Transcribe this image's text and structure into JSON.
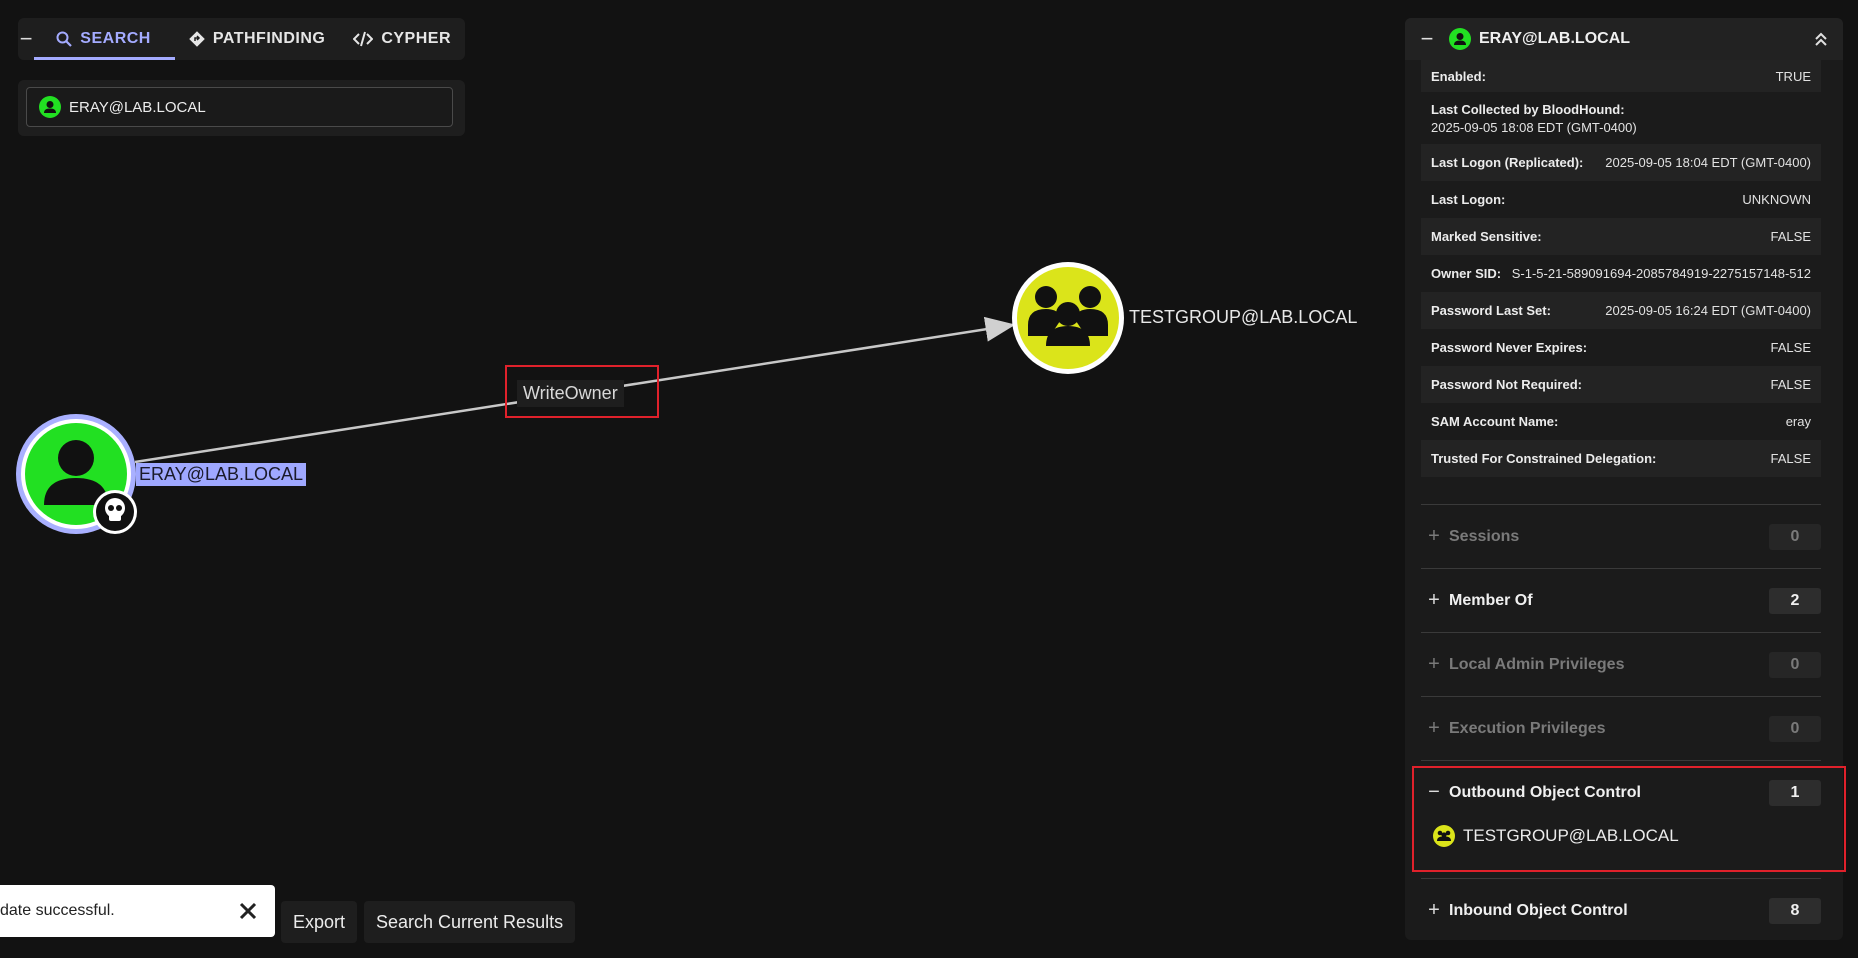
{
  "nav": {
    "collapse_label": "−",
    "tabs": [
      {
        "label": "SEARCH",
        "icon": "search-icon",
        "active": true
      },
      {
        "label": "PATHFINDING",
        "icon": "diamond-arrow-icon",
        "active": false
      },
      {
        "label": "CYPHER",
        "icon": "code-icon",
        "active": false
      }
    ]
  },
  "search": {
    "value": "ERAY@LAB.LOCAL",
    "icon": "user-icon"
  },
  "graph": {
    "edge_label": "WriteOwner",
    "source_node": {
      "label": "ERAY@LAB.LOCAL",
      "icon": "user-icon",
      "badge": "skull-icon"
    },
    "target_node": {
      "label": "TESTGROUP@LAB.LOCAL",
      "icon": "group-icon"
    }
  },
  "toast": {
    "message": "date successful."
  },
  "buttons": {
    "export": "Export",
    "search_results": "Search Current Results"
  },
  "entity": {
    "title": "ERAY@LAB.LOCAL",
    "properties": [
      {
        "key": "Enabled:",
        "value": "TRUE"
      },
      {
        "key": "Last Collected by BloodHound:",
        "value": "2025-09-05 18:08 EDT (GMT-0400)",
        "stacked": true
      },
      {
        "key": "Last Logon (Replicated):",
        "value": "2025-09-05 18:04 EDT (GMT-0400)"
      },
      {
        "key": "Last Logon:",
        "value": "UNKNOWN"
      },
      {
        "key": "Marked Sensitive:",
        "value": "FALSE"
      },
      {
        "key": "Owner SID:",
        "value": "S-1-5-21-589091694-2085784919-2275157148-512"
      },
      {
        "key": "Password Last Set:",
        "value": "2025-09-05 16:24 EDT (GMT-0400)"
      },
      {
        "key": "Password Never Expires:",
        "value": "FALSE"
      },
      {
        "key": "Password Not Required:",
        "value": "FALSE"
      },
      {
        "key": "SAM Account Name:",
        "value": "eray"
      },
      {
        "key": "Trusted For Constrained Delegation:",
        "value": "FALSE"
      }
    ],
    "sections": [
      {
        "label": "Sessions",
        "count": "0",
        "symbol": "+",
        "dim": true
      },
      {
        "label": "Member Of",
        "count": "2",
        "symbol": "+",
        "dim": false
      },
      {
        "label": "Local Admin Privileges",
        "count": "0",
        "symbol": "+",
        "dim": true
      },
      {
        "label": "Execution Privileges",
        "count": "0",
        "symbol": "+",
        "dim": true
      },
      {
        "label": "Outbound Object Control",
        "count": "1",
        "symbol": "−",
        "dim": false
      },
      {
        "label": "Inbound Object Control",
        "count": "8",
        "symbol": "+",
        "dim": false
      }
    ],
    "outbound_item": "TESTGROUP@LAB.LOCAL"
  },
  "colors": {
    "accent": "#a4abff",
    "user_node": "#22e022",
    "group_node": "#dbe41a",
    "highlight": "#e0212b"
  }
}
